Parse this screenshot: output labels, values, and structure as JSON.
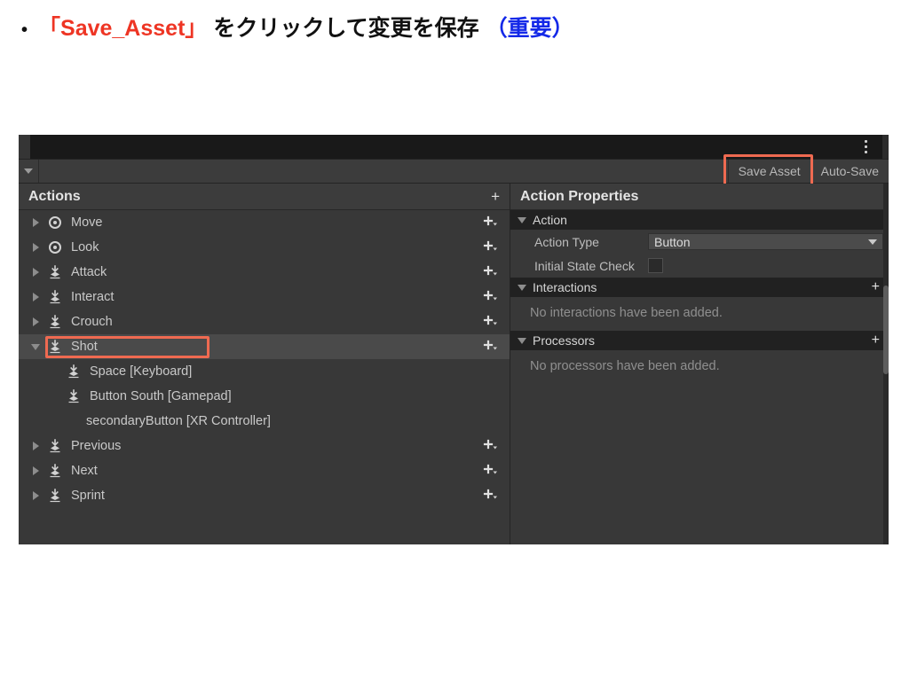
{
  "slide": {
    "bullet_marker": "•",
    "text_parts": [
      {
        "text": "「Save_Asset」",
        "style": "red"
      },
      {
        "text": " をクリックして変更を保存 ",
        "style": "plain"
      },
      {
        "text": "（重要）",
        "style": "blue"
      }
    ],
    "highlight_color": "#ef6a51"
  },
  "window": {
    "tab_strip": {
      "kebab_icon": "kebab-menu-icon"
    },
    "toolbar": {
      "control_scheme_caret": "chevron-down-icon",
      "save_asset_label": "Save Asset",
      "auto_save_label": "Auto-Save",
      "save_asset_highlighted": true
    },
    "actions_pane": {
      "title": "Actions",
      "add_label": "+",
      "rows": [
        {
          "label": "Move",
          "icon": "value-stick-icon",
          "foldout": "right",
          "indent": "top",
          "selected": false,
          "has_plus": true
        },
        {
          "label": "Look",
          "icon": "value-stick-icon",
          "foldout": "right",
          "indent": "top",
          "selected": false,
          "has_plus": true
        },
        {
          "label": "Attack",
          "icon": "button-press-icon",
          "foldout": "right",
          "indent": "top",
          "selected": false,
          "has_plus": true
        },
        {
          "label": "Interact",
          "icon": "button-press-icon",
          "foldout": "right",
          "indent": "top",
          "selected": false,
          "has_plus": true
        },
        {
          "label": "Crouch",
          "icon": "button-press-icon",
          "foldout": "right",
          "indent": "top",
          "selected": false,
          "has_plus": true
        },
        {
          "label": "Shot",
          "icon": "button-press-icon",
          "foldout": "down",
          "indent": "top",
          "selected": true,
          "has_plus": true
        },
        {
          "label": "Space [Keyboard]",
          "icon": "button-press-icon",
          "foldout": "none",
          "indent": "child",
          "selected": false,
          "has_plus": false
        },
        {
          "label": "Button South [Gamepad]",
          "icon": "button-press-icon",
          "foldout": "none",
          "indent": "child",
          "selected": false,
          "has_plus": false
        },
        {
          "label": "secondaryButton [XR Controller]",
          "icon": "none",
          "foldout": "none",
          "indent": "child",
          "selected": false,
          "has_plus": false
        },
        {
          "label": "Previous",
          "icon": "button-press-icon",
          "foldout": "right",
          "indent": "top",
          "selected": false,
          "has_plus": true
        },
        {
          "label": "Next",
          "icon": "button-press-icon",
          "foldout": "right",
          "indent": "top",
          "selected": false,
          "has_plus": true
        },
        {
          "label": "Sprint",
          "icon": "button-press-icon",
          "foldout": "right",
          "indent": "top",
          "selected": false,
          "has_plus": true
        }
      ]
    },
    "properties_pane": {
      "title": "Action Properties",
      "action_section": {
        "header": "Action",
        "action_type_label": "Action Type",
        "action_type_value": "Button",
        "initial_state_check_label": "Initial State Check",
        "initial_state_check_value": false
      },
      "interactions_section": {
        "header": "Interactions",
        "add_label": "+",
        "empty_text": "No interactions have been added."
      },
      "processors_section": {
        "header": "Processors",
        "add_label": "+",
        "empty_text": "No processors have been added."
      }
    }
  }
}
